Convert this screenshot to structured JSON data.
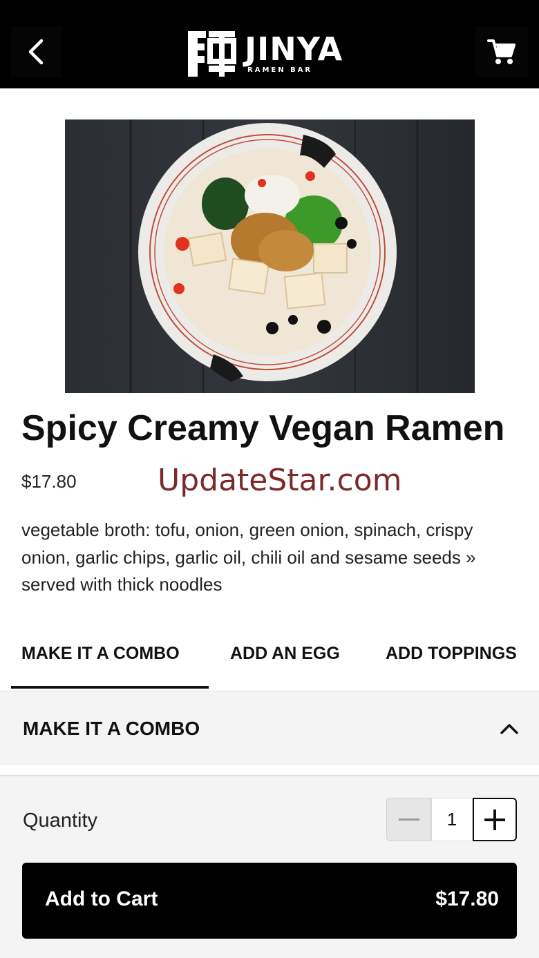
{
  "header": {
    "logo_name": "JINYA",
    "logo_sub": "RAMEN BAR",
    "back_icon": "chevron-left-icon",
    "cart_icon": "cart-icon"
  },
  "product": {
    "title": "Spicy Creamy Vegan Ramen",
    "price": "$17.80",
    "description": "vegetable broth: tofu, onion, green onion, spinach, crispy onion, garlic chips, garlic oil, chili oil and sesame seeds » served with thick noodles"
  },
  "watermark": "UpdateStar.com",
  "tabs": [
    {
      "label": "MAKE IT A COMBO",
      "active": true
    },
    {
      "label": "ADD AN EGG",
      "active": false
    },
    {
      "label": "ADD TOPPINGS",
      "active": false
    }
  ],
  "section": {
    "title": "MAKE IT A COMBO",
    "expanded": true
  },
  "quantity": {
    "label": "Quantity",
    "value": "1"
  },
  "cart_button": {
    "label": "Add to Cart",
    "price": "$17.80"
  },
  "colors": {
    "header_bg": "#000000",
    "panel_bg": "#f4f4f4",
    "watermark": "#7a2a2a"
  }
}
